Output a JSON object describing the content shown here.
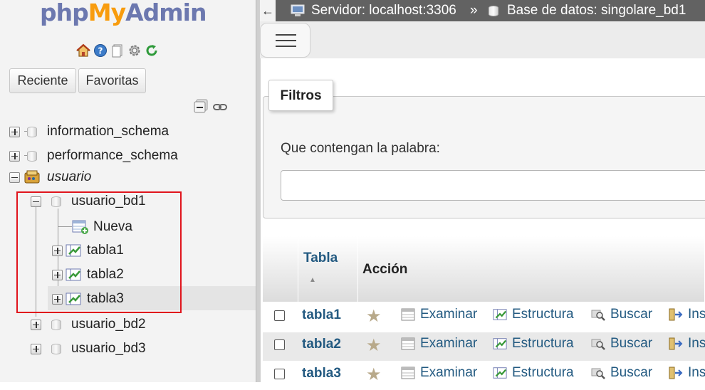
{
  "app": {
    "logo_php": "php",
    "logo_my": "My",
    "logo_admin": "Admin"
  },
  "nav_tabs": {
    "recent": "Reciente",
    "favorites": "Favoritas"
  },
  "tree": {
    "info_schema": "information_schema",
    "perf_schema": "performance_schema",
    "usuario_group": "usuario",
    "usuario_bd1": "usuario_bd1",
    "nueva": "Nueva",
    "tabla1": "tabla1",
    "tabla2": "tabla2",
    "tabla3": "tabla3",
    "usuario_bd2": "usuario_bd2",
    "usuario_bd3": "usuario_bd3"
  },
  "breadcrumb": {
    "back": "←",
    "server": "Servidor: localhost:3306",
    "sep": "»",
    "database": "Base de datos: singolare_bd1"
  },
  "filters": {
    "legend": "Filtros",
    "label": "Que contengan la palabra:",
    "value": ""
  },
  "table": {
    "col_table": "Tabla",
    "col_action": "Acción",
    "sort_indicator": "▲",
    "rows": [
      {
        "name": "tabla1",
        "browse": "Examinar",
        "structure": "Estructura",
        "search": "Buscar",
        "insert": "Ins"
      },
      {
        "name": "tabla2",
        "browse": "Examinar",
        "structure": "Estructura",
        "search": "Buscar",
        "insert": "Ins"
      },
      {
        "name": "tabla3",
        "browse": "Examinar",
        "structure": "Estructura",
        "search": "Buscar",
        "insert": "Ins"
      }
    ]
  },
  "colors": {
    "link": "#235a81",
    "highlight_border": "#e0141c",
    "topbar": "#626262",
    "logo_blue": "#6c78af",
    "logo_orange": "#f89c0e"
  },
  "icons": [
    "home-icon",
    "help-icon",
    "docs-icon",
    "settings-icon",
    "reload-icon",
    "collapse-all-icon",
    "link-icon",
    "database-icon",
    "table-icon",
    "new-table-icon",
    "favorite-star-icon",
    "browse-icon",
    "structure-icon",
    "search-icon",
    "insert-icon",
    "menu-icon"
  ]
}
